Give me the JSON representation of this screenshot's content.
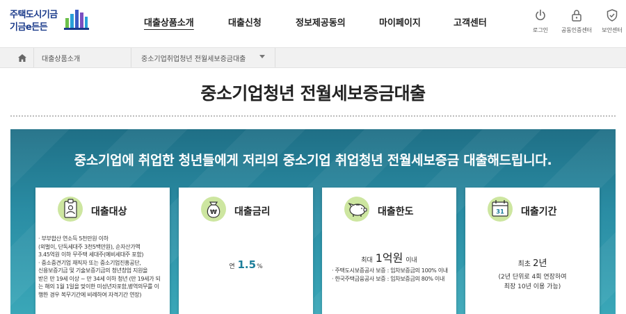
{
  "logo": {
    "line1": "주택도시기금",
    "line2": "기금e든든"
  },
  "nav": [
    {
      "label": "대출상품소개",
      "active": true
    },
    {
      "label": "대출신청",
      "active": false
    },
    {
      "label": "정보제공동의",
      "active": false
    },
    {
      "label": "마이페이지",
      "active": false
    },
    {
      "label": "고객센터",
      "active": false
    }
  ],
  "utility": [
    {
      "label": "로그인",
      "icon": "power-icon"
    },
    {
      "label": "공동인증센터",
      "icon": "lock-icon"
    },
    {
      "label": "보안센터",
      "icon": "shield-icon"
    }
  ],
  "breadcrumb": {
    "level1": "대출상품소개",
    "level2": "중소기업취업청년 전월세보증금대출"
  },
  "page_title": "중소기업청년 전월세보증금대출",
  "banner": {
    "headline": "중소기업에 취업한 청년들에게 저리의 중소기업 취업청년 전월세보증금 대출해드립니다."
  },
  "cards": {
    "target": {
      "title": "대출대상",
      "icon": "id-card-icon",
      "lines": [
        "· 부부합산 연소득 5천만원 이하",
        "  (외벌이, 단독세대주 3천5백만원), 순자산가액",
        "  3.45억원 이하  무주택 세대주(예비세대주 포함)",
        "· 중소중견기업 재직자 또는  중소기업진흥공단,",
        "  신용보증기금 및  기술보증기금의 청년창업 지원을",
        "  받은  만 19세 이상 ~ 만 34세 이하 청년 (만 19세가 되",
        "  는 해의 1월 1일을 맞이한 미성년자포함,병역의무를 이",
        "  행한 경우 복무기간에 비례하여 자격기간 연장)"
      ]
    },
    "rate": {
      "title": "대출금리",
      "icon": "money-bag-icon",
      "prefix": "연",
      "value": "1.5",
      "unit": "%"
    },
    "limit": {
      "title": "대출한도",
      "icon": "piggy-bank-icon",
      "prefix": "최대",
      "value": "1억원",
      "suffix": "이내",
      "notes": [
        "· 주택도시보증공사 보증 : 임차보증금의 100% 이내",
        "· 한국주택금융공사 보증 : 임차보증금의 80% 이내"
      ]
    },
    "period": {
      "title": "대출기간",
      "icon": "calendar-icon",
      "calendar_day": "31",
      "prefix": "최초",
      "value": "2년",
      "desc1": "(2년 단위로 4회 연장하여",
      "desc2": "최장 10년 이용 가능)"
    }
  },
  "colors": {
    "brand_navy": "#1a3a8a",
    "banner_teal": "#2a8da4",
    "accent_rate": "#1c7e9a",
    "icon_circle": "#cde6a0"
  }
}
